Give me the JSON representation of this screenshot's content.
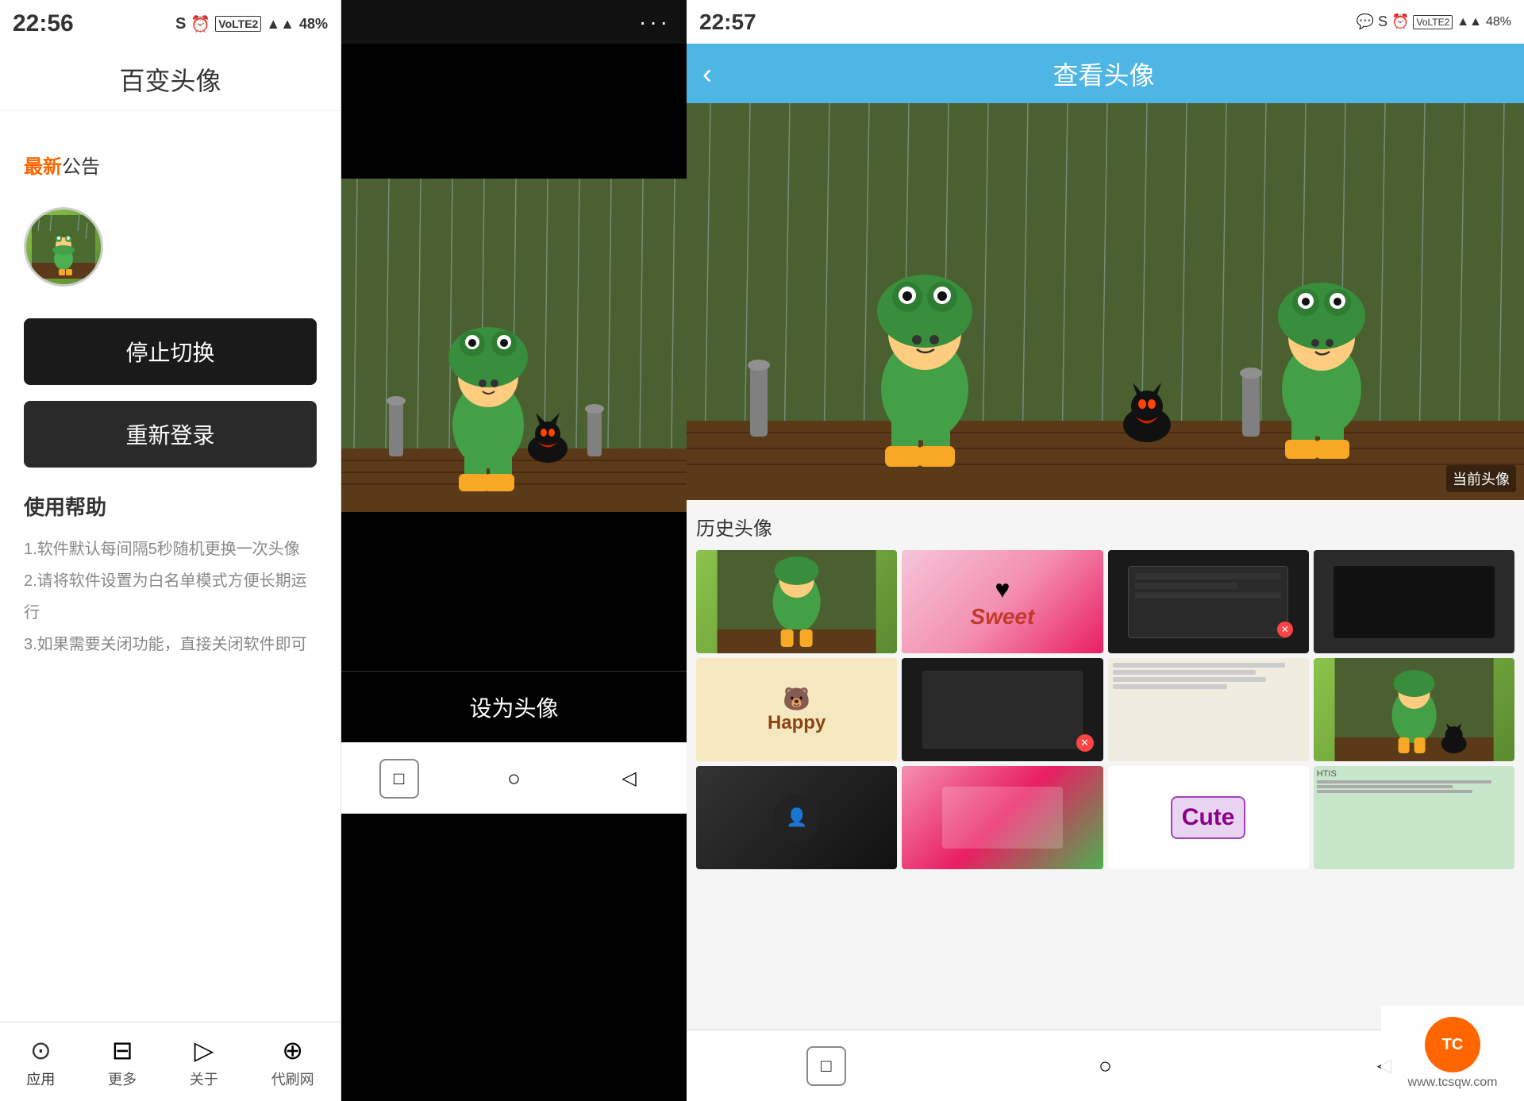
{
  "panel_left": {
    "status_bar": {
      "time": "22:56",
      "battery": "48%"
    },
    "app_title": "百变头像",
    "announcement": {
      "label_new": "最新",
      "label_text": "公告"
    },
    "buttons": {
      "stop_switch": "停止切换",
      "relogin": "重新登录"
    },
    "help": {
      "title": "使用帮助",
      "lines": [
        "1.软件默认每间隔5秒随机更换一次头像",
        "2.请将软件设置为白名单模式方便长期运行",
        "3.如果需要关闭功能，直接关闭软件即可"
      ]
    },
    "bottom_nav": [
      {
        "label": "应用",
        "icon": "⊙"
      },
      {
        "label": "更多",
        "icon": "⊟"
      },
      {
        "label": "关于",
        "icon": "▷"
      },
      {
        "label": "代刷网",
        "icon": "⊕"
      }
    ]
  },
  "panel_middle": {
    "dots_menu": "···",
    "set_avatar_btn": "设为头像",
    "bottom_nav": [
      "□",
      "○",
      "△"
    ]
  },
  "panel_right": {
    "status_bar": {
      "time": "22:57",
      "battery": "48%"
    },
    "header": {
      "back_label": "‹",
      "title": "查看头像"
    },
    "current_avatar_label": "当前头像",
    "history": {
      "title": "历史头像",
      "items": [
        {
          "id": 1,
          "text": "",
          "theme": "hi-1"
        },
        {
          "id": 2,
          "text": "Sweet",
          "theme": "hi-2",
          "label_class": "sweet-label"
        },
        {
          "id": 3,
          "text": "",
          "theme": "hi-3"
        },
        {
          "id": 4,
          "text": "",
          "theme": "hi-4"
        },
        {
          "id": 5,
          "text": "",
          "theme": "hi-5"
        },
        {
          "id": 6,
          "text": "",
          "theme": "hi-6"
        },
        {
          "id": 7,
          "text": "",
          "theme": "hi-7"
        },
        {
          "id": 8,
          "text": "",
          "theme": "hi-8"
        },
        {
          "id": 9,
          "text": "",
          "theme": "hi-9"
        },
        {
          "id": 10,
          "text": "Happy",
          "theme": "hi-4",
          "label_class": "happy-label"
        },
        {
          "id": 11,
          "text": "",
          "theme": "hi-5"
        },
        {
          "id": 12,
          "text": "",
          "theme": "hi-6"
        },
        {
          "id": 13,
          "text": "",
          "theme": "hi-7"
        },
        {
          "id": 14,
          "text": "Cute",
          "theme": "hi-2",
          "label_class": "cute-label"
        },
        {
          "id": 15,
          "text": "",
          "theme": "hi-8"
        },
        {
          "id": 16,
          "text": "",
          "theme": "hi-7"
        }
      ]
    },
    "bottom_nav": [
      "□",
      "○",
      "△"
    ]
  },
  "tc_watermark": {
    "logo": "TC",
    "site": "www.tcsqw.com"
  }
}
